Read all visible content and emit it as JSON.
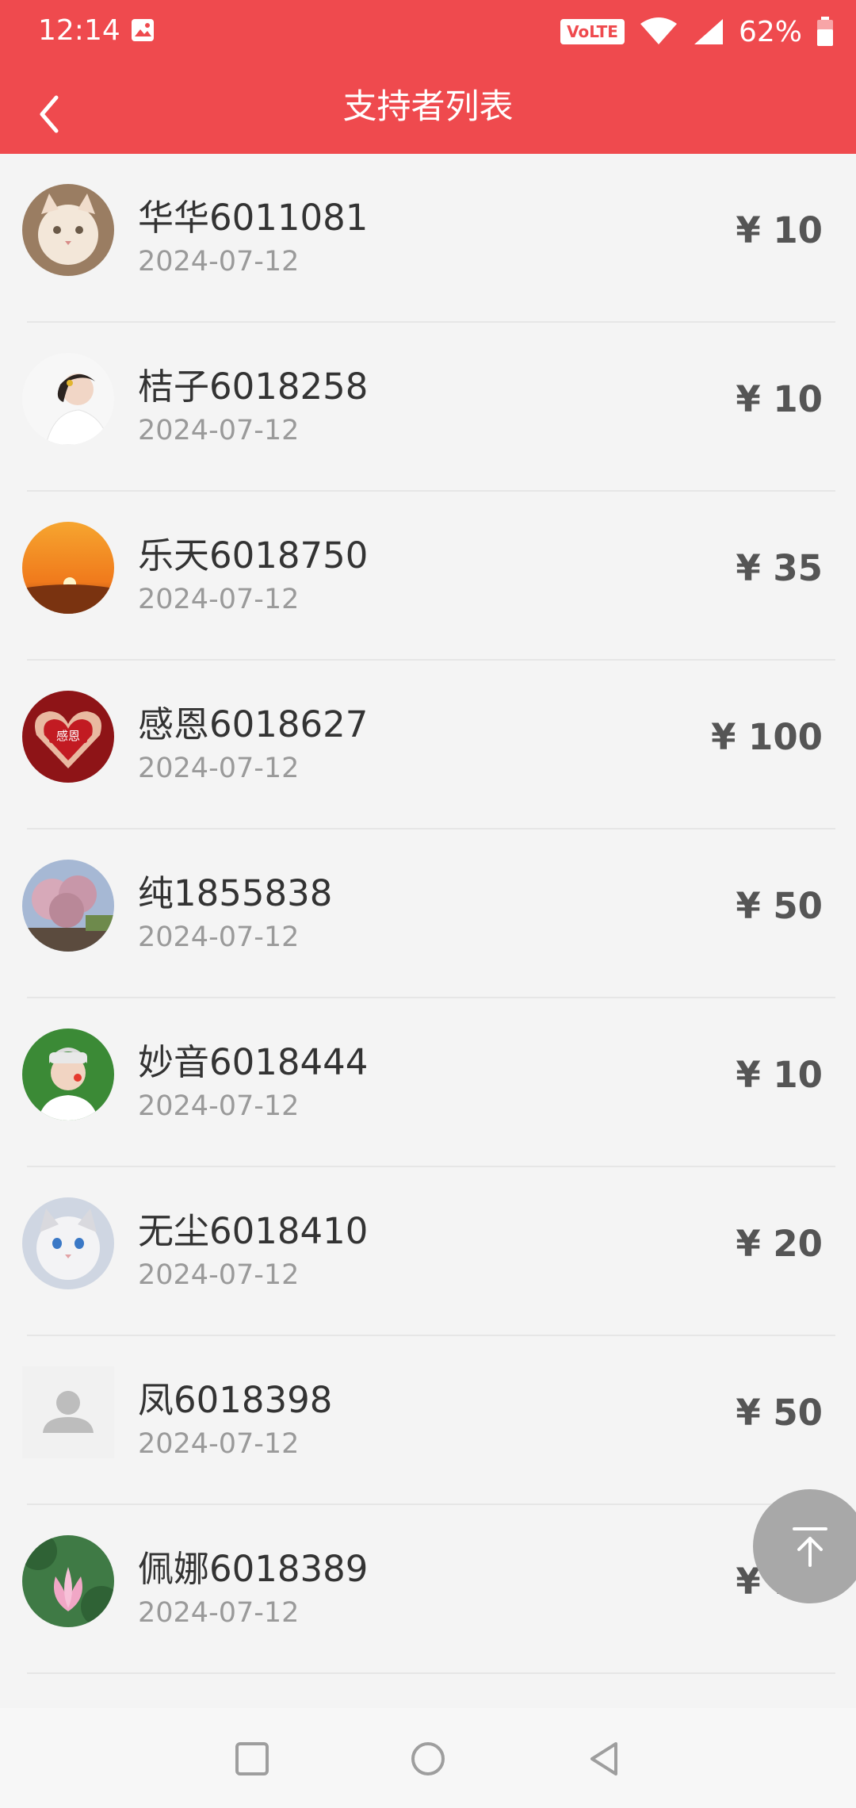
{
  "status_bar": {
    "time": "12:14",
    "volte": "VoLTE",
    "battery": "62%"
  },
  "header": {
    "title": "支持者列表"
  },
  "currency_symbol": "¥",
  "supporters": [
    {
      "name": "华华6011081",
      "date": "2024-07-12",
      "amount": "¥ 10",
      "avatar": "kitten"
    },
    {
      "name": "桔子6018258",
      "date": "2024-07-12",
      "amount": "¥ 10",
      "avatar": "girl-portrait"
    },
    {
      "name": "乐天6018750",
      "date": "2024-07-12",
      "amount": "¥ 35",
      "avatar": "sunset"
    },
    {
      "name": "感恩6018627",
      "date": "2024-07-12",
      "amount": "¥ 100",
      "avatar": "heart-hands"
    },
    {
      "name": "纯1855838",
      "date": "2024-07-12",
      "amount": "¥ 50",
      "avatar": "blossom-tree"
    },
    {
      "name": "妙音6018444",
      "date": "2024-07-12",
      "amount": "¥ 10",
      "avatar": "woman-portrait"
    },
    {
      "name": "无尘6018410",
      "date": "2024-07-12",
      "amount": "¥ 20",
      "avatar": "white-cat"
    },
    {
      "name": "凤6018398",
      "date": "2024-07-12",
      "amount": "¥ 50",
      "avatar": "default-user"
    },
    {
      "name": "佩娜6018389",
      "date": "2024-07-12",
      "amount": "¥ 10",
      "avatar": "lotus"
    }
  ],
  "colors": {
    "header_bg": "#ef4a4e",
    "page_bg": "#f4f4f4"
  }
}
